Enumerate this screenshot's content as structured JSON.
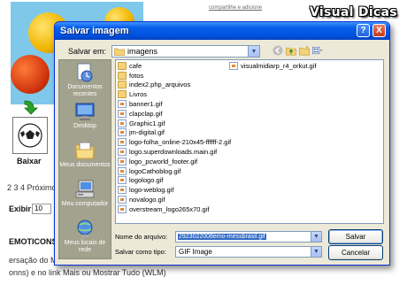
{
  "background": {
    "top_link": "compartilhe e adicione",
    "site_title": "Visual Dicas",
    "download_label": "Baixar",
    "pagination": "2 3 4 Próximo",
    "show_label": "Exibir",
    "show_value": "10",
    "section_title": "EMOTICONS",
    "text_line1": "ersação do M",
    "text_line2": "onns) e no link Mais ou Mostrar Tudo (WLM)"
  },
  "dialog": {
    "title": "Salvar imagem",
    "help_button": "?",
    "close_button": "X",
    "lookin_label": "Salvar em:",
    "lookin_value": "imagens",
    "places": [
      {
        "label": "Documentos recentes",
        "icon": "recent-documents-icon"
      },
      {
        "label": "Desktop",
        "icon": "desktop-icon"
      },
      {
        "label": "Meus documentos",
        "icon": "my-documents-icon"
      },
      {
        "label": "Meu computador",
        "icon": "my-computer-icon"
      },
      {
        "label": "Meus locais de rede",
        "icon": "network-places-icon"
      }
    ],
    "files_col1": [
      {
        "name": "cafe",
        "kind": "folder"
      },
      {
        "name": "fotos",
        "kind": "folder"
      },
      {
        "name": "index2.php_arquivos",
        "kind": "folder"
      },
      {
        "name": "Livros",
        "kind": "folder"
      },
      {
        "name": "banner1.gif",
        "kind": "gif"
      },
      {
        "name": "clapclap.gif",
        "kind": "gif"
      },
      {
        "name": "Graphic1.gif",
        "kind": "gif"
      },
      {
        "name": "jm-digital.gif",
        "kind": "gif"
      },
      {
        "name": "logo-folha_online-210x45-ffffff-2.gif",
        "kind": "gif"
      },
      {
        "name": "logo.superdownloads.main.gif",
        "kind": "gif"
      },
      {
        "name": "logo_pcworld_footer.gif",
        "kind": "gif"
      },
      {
        "name": "logoCathoblog.gif",
        "kind": "gif"
      },
      {
        "name": "logologo.gif",
        "kind": "gif"
      },
      {
        "name": "logo-weblog.gif",
        "kind": "gif"
      },
      {
        "name": "novalogo.gif",
        "kind": "gif"
      },
      {
        "name": "overstream_logo265x70.gif",
        "kind": "gif"
      }
    ],
    "files_col2": [
      {
        "name": "visualmidiarp_r4_orkut.gif",
        "kind": "gif"
      }
    ],
    "filename_label": "Nome do arquivo:",
    "filename_value": "2923022008emo-messbrasil.gif",
    "filetype_label": "Salvar como tipo:",
    "filetype_value": "GIF Image",
    "save_button": "Salvar",
    "cancel_button": "Cancelar"
  }
}
